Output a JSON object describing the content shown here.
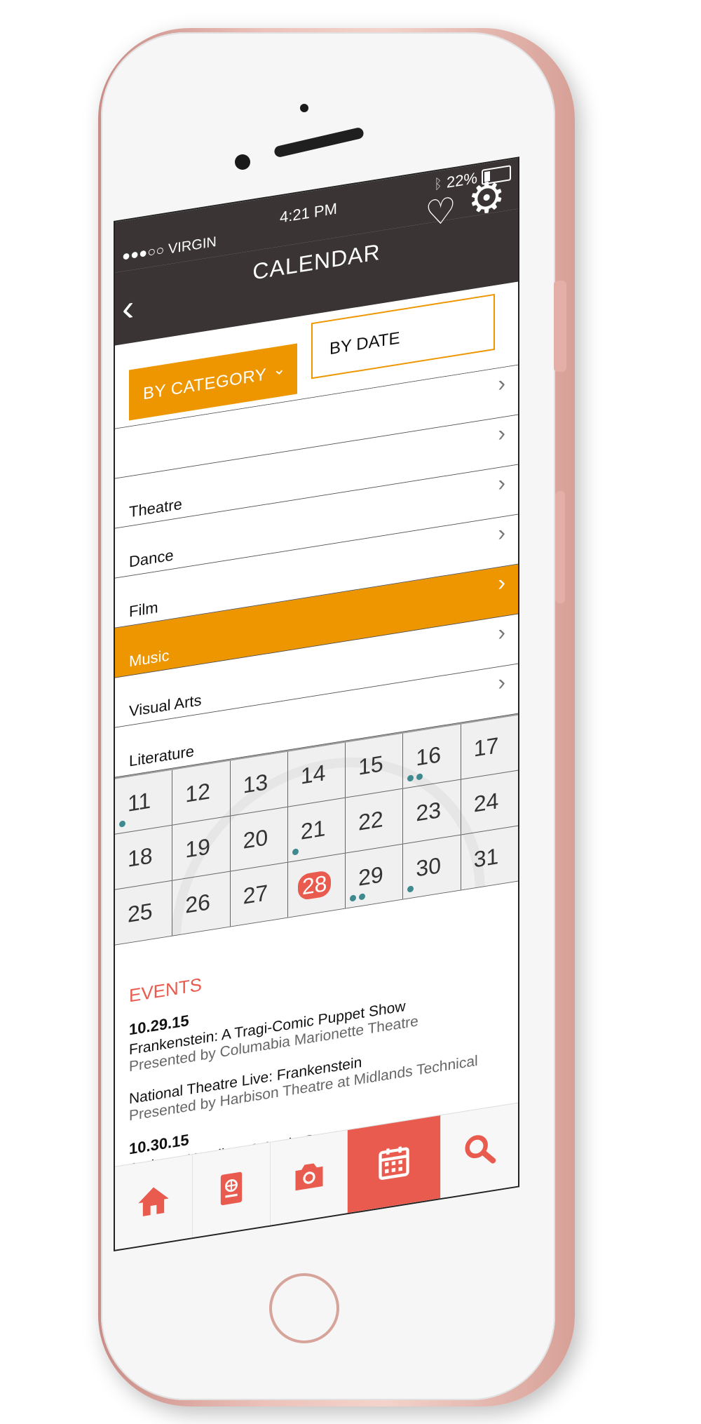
{
  "status": {
    "carrier": "●●●○○ VIRGIN",
    "time": "4:21 PM",
    "battery": "22%"
  },
  "nav": {
    "title": "CALENDAR",
    "back_icon": "chevron-left-icon",
    "favorite_icon": "heart-icon",
    "settings_icon": "gear-icon"
  },
  "filters": {
    "by_category": "BY CATEGORY",
    "by_date": "BY DATE"
  },
  "categories": [
    {
      "label": "",
      "active": false
    },
    {
      "label": "Theatre",
      "active": false
    },
    {
      "label": "Dance",
      "active": false
    },
    {
      "label": "Film",
      "active": false
    },
    {
      "label": "Music",
      "active": true
    },
    {
      "label": "Visual Arts",
      "active": false
    },
    {
      "label": "Literature",
      "active": false
    }
  ],
  "calendar": {
    "weeks": [
      [
        {
          "d": "11",
          "dots": 1
        },
        {
          "d": "12",
          "dots": 0
        },
        {
          "d": "13",
          "dots": 0
        },
        {
          "d": "14",
          "dots": 0
        },
        {
          "d": "15",
          "dots": 0
        },
        {
          "d": "16",
          "dots": 2
        },
        {
          "d": "17",
          "dots": 0
        }
      ],
      [
        {
          "d": "18",
          "dots": 0
        },
        {
          "d": "19",
          "dots": 0
        },
        {
          "d": "20",
          "dots": 0
        },
        {
          "d": "21",
          "dots": 1
        },
        {
          "d": "22",
          "dots": 0
        },
        {
          "d": "23",
          "dots": 0
        },
        {
          "d": "24",
          "dots": 0
        }
      ],
      [
        {
          "d": "25",
          "dots": 0
        },
        {
          "d": "26",
          "dots": 0
        },
        {
          "d": "27",
          "dots": 0
        },
        {
          "d": "28",
          "dots": 0,
          "today": true
        },
        {
          "d": "29",
          "dots": 2
        },
        {
          "d": "30",
          "dots": 1
        },
        {
          "d": "31",
          "dots": 0
        }
      ]
    ]
  },
  "events": {
    "heading": "EVENTS",
    "groups": [
      {
        "date": "10.29.15",
        "items": [
          {
            "title": "Frankenstein: A Tragi-Comic Puppet Show",
            "sub": "Presented by Columabia Marionette Theatre"
          },
          {
            "title": "National Theatre Live: Frankenstein",
            "sub": "Presented by Harbison Theatre at Midlands Technical"
          }
        ]
      },
      {
        "date": "10.30.15",
        "items": [
          {
            "title": "Anthony Hamilton & Angie Stone",
            "sub": ""
          }
        ]
      }
    ]
  },
  "tabs": [
    {
      "name": "home-icon",
      "active": false
    },
    {
      "name": "passport-icon",
      "active": false
    },
    {
      "name": "camera-icon",
      "active": false
    },
    {
      "name": "calendar-icon",
      "active": true
    },
    {
      "name": "search-icon",
      "active": false
    }
  ],
  "colors": {
    "accent_orange": "#ee9600",
    "accent_red": "#e95b4e",
    "dot_teal": "#3f8a8e",
    "bar_dark": "#3a3534"
  }
}
